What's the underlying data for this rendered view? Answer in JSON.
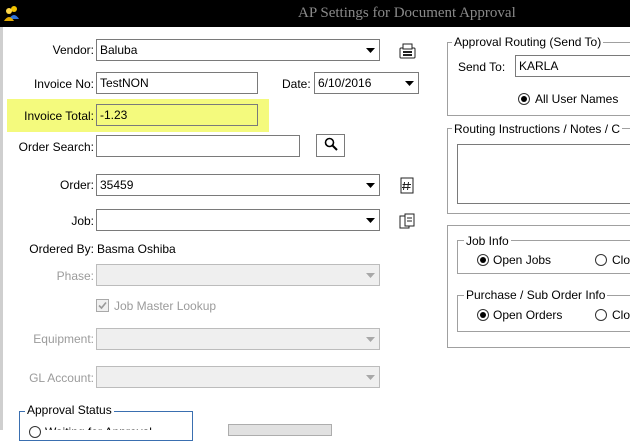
{
  "window": {
    "title": "AP Settings for Document Approval"
  },
  "form": {
    "vendor": {
      "label": "Vendor:",
      "value": "Baluba"
    },
    "invoice_no": {
      "label": "Invoice No:",
      "value": "TestNON"
    },
    "date": {
      "label": "Date:",
      "value": "6/10/2016"
    },
    "invoice_total": {
      "label": "Invoice Total:",
      "value": "-1.23"
    },
    "order_search": {
      "label": "Order Search:",
      "value": ""
    },
    "order": {
      "label": "Order:",
      "value": "35459"
    },
    "job": {
      "label": "Job:",
      "value": ""
    },
    "ordered_by": {
      "label": "Ordered By:",
      "value": "Basma Oshiba"
    },
    "phase": {
      "label": "Phase:",
      "value": ""
    },
    "job_master_lookup": {
      "label": "Job Master Lookup",
      "checked": true
    },
    "equipment": {
      "label": "Equipment:",
      "value": ""
    },
    "gl_account": {
      "label": "GL Account:",
      "value": ""
    }
  },
  "approval_status": {
    "label": "Approval Status",
    "option_partial": "Waiting for Approval"
  },
  "approval_routing": {
    "label": "Approval Routing (Send To)",
    "send_to_label": "Send To:",
    "send_to_value": "KARLA",
    "all_user_names": "All User Names"
  },
  "routing_instructions": {
    "label": "Routing Instructions / Notes / C"
  },
  "job_info": {
    "label": "Job Info",
    "open_jobs": "Open Jobs",
    "closed_partial": "Clo"
  },
  "purchase_info": {
    "label": "Purchase / Sub Order Info",
    "open_orders": "Open Orders",
    "closed_partial": "Clo"
  },
  "colors": {
    "highlight": "#f4fa7d",
    "titlebar": "#000000"
  }
}
